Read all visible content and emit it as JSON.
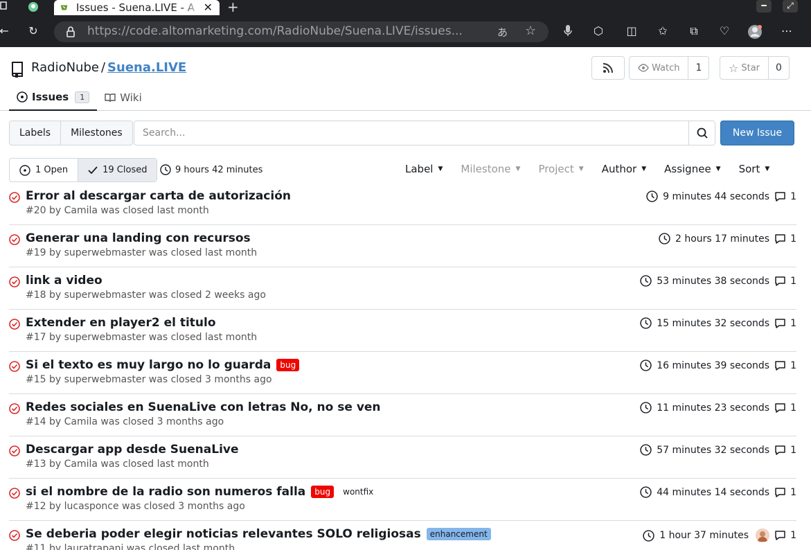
{
  "browser": {
    "tab_title": "Issues - Suena.LIVE - A",
    "url_host": "https://code.altomarketing.com",
    "url_path": "/RadioNube/Suena.LIVE/issues...",
    "read_aloud_glyph": "あ"
  },
  "repo": {
    "owner": "RadioNube",
    "separator": "/",
    "name": "Suena.LIVE",
    "watch_label": "Watch",
    "watch_count": "1",
    "star_label": "Star",
    "star_count": "0",
    "tabs": [
      {
        "label": "Issues",
        "badge": "1"
      },
      {
        "label": "Wiki"
      }
    ]
  },
  "toolbar": {
    "labels_label": "Labels",
    "milestones_label": "Milestones",
    "search_placeholder": "Search...",
    "new_issue_label": "New Issue",
    "open_label": "1 Open",
    "closed_label": "19 Closed",
    "total_time": "9 hours 42 minutes",
    "filters": [
      "Label",
      "Milestone",
      "Project",
      "Author",
      "Assignee",
      "Sort"
    ]
  },
  "issues": [
    {
      "title": "Error al descargar carta de autorización",
      "meta": "#20 by Camila was closed last month",
      "time": "9 minutes 44 seconds",
      "comments": "1"
    },
    {
      "title": "Generar una landing con recursos",
      "meta": "#19 by superwebmaster was closed last month",
      "time": "2 hours 17 minutes",
      "comments": "1"
    },
    {
      "title": "link a video",
      "meta": "#18 by superwebmaster was closed 2 weeks ago",
      "time": "53 minutes 38 seconds",
      "comments": "1"
    },
    {
      "title": "Extender en player2 el titulo",
      "meta": "#17 by superwebmaster was closed last month",
      "time": "15 minutes 32 seconds",
      "comments": "1"
    },
    {
      "title": "Si el texto es muy largo no lo guarda",
      "labels": [
        "bug"
      ],
      "meta": "#15 by superwebmaster was closed 3 months ago",
      "time": "16 minutes 39 seconds",
      "comments": "1"
    },
    {
      "title": "Redes sociales en SuenaLive con letras No, no se ven",
      "meta": "#14 by Camila was closed 3 months ago",
      "time": "11 minutes 23 seconds",
      "comments": "1"
    },
    {
      "title": "Descargar app desde SuenaLive",
      "meta": "#13 by Camila was closed last month",
      "time": "57 minutes 32 seconds",
      "comments": "1"
    },
    {
      "title": "si el nombre de la radio son numeros falla",
      "labels": [
        "bug",
        "wontfix"
      ],
      "meta": "#12 by lucasponce was closed 3 months ago",
      "time": "44 minutes 14 seconds",
      "comments": "1"
    },
    {
      "title": "Se deberia poder elegir noticias relevantes SOLO religiosas",
      "labels": [
        "enhancement"
      ],
      "meta": "#11 by lauratrapani was closed last month",
      "time": "1 hour 37 minutes",
      "comments": "1",
      "assignee_avatar": true
    }
  ],
  "colors": {
    "accent": "#4183c4",
    "closed_red": "#db2828",
    "label_bug": "#ee0701",
    "label_enhancement": "#84b6eb",
    "chrome_bg": "#202124"
  }
}
